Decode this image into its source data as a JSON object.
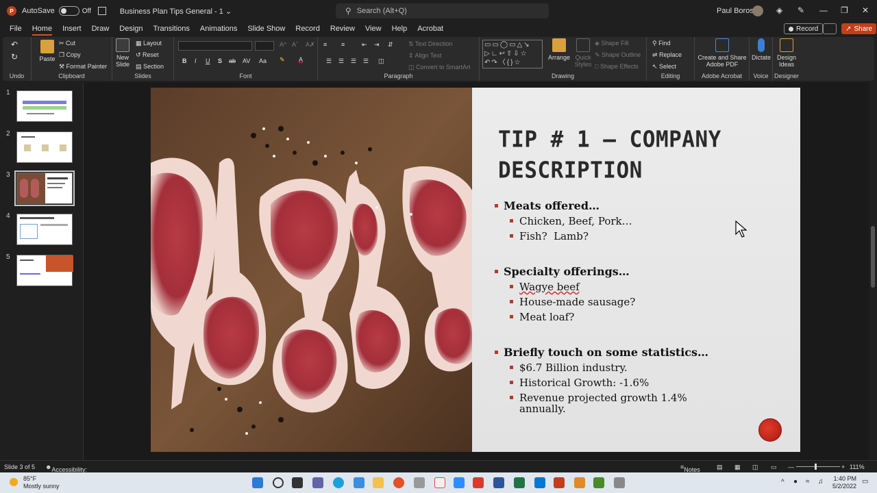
{
  "titlebar": {
    "autosave_label": "AutoSave",
    "autosave_state": "Off",
    "doc_title": "Business Plan Tips General - 1 ⌄",
    "search_placeholder": "Search (Alt+Q)",
    "user_name": "Paul Borosky"
  },
  "menu": {
    "items": [
      "File",
      "Home",
      "Insert",
      "Draw",
      "Design",
      "Transitions",
      "Animations",
      "Slide Show",
      "Record",
      "Review",
      "View",
      "Help",
      "Acrobat"
    ],
    "active": "Home",
    "record_label": "Record",
    "share_label": "Share"
  },
  "ribbon": {
    "undo": {
      "label": "Undo"
    },
    "clipboard": {
      "paste": "Paste",
      "cut": "Cut",
      "copy": "Copy",
      "format_painter": "Format Painter",
      "label": "Clipboard"
    },
    "slides": {
      "new_slide": "New Slide",
      "layout": "Layout",
      "reset": "Reset",
      "section": "Section",
      "label": "Slides"
    },
    "font": {
      "label": "Font",
      "bold": "B",
      "italic": "I",
      "underline": "U",
      "strike": "S",
      "ab": "ab",
      "aa": "Aa"
    },
    "paragraph": {
      "label": "Paragraph",
      "text_direction": "Text Direction",
      "align_text": "Align Text",
      "convert_smartart": "Convert to SmartArt"
    },
    "drawing": {
      "label": "Drawing",
      "arrange": "Arrange",
      "quick_styles": "Quick Styles",
      "shape_fill": "Shape Fill",
      "shape_outline": "Shape Outline",
      "shape_effects": "Shape Effects"
    },
    "editing": {
      "label": "Editing",
      "find": "Find",
      "replace": "Replace",
      "select": "Select"
    },
    "acrobat": {
      "label": "Adobe Acrobat",
      "create_share": "Create and Share Adobe PDF"
    },
    "voice": {
      "label": "Voice",
      "dictate": "Dictate"
    },
    "designer": {
      "label": "Designer",
      "design_ideas": "Design Ideas"
    }
  },
  "thumbnails": {
    "numbers": [
      "1",
      "2",
      "3",
      "4",
      "5"
    ],
    "active_index": 3
  },
  "slide": {
    "title_line1": "TIP # 1 – COMPANY",
    "title_line2": "DESCRIPTION",
    "sections": [
      {
        "heading": "Meats offered…",
        "items": [
          "Chicken, Beef, Pork…",
          "Fish?  Lamb?"
        ]
      },
      {
        "heading": "Specialty offerings…",
        "items": [
          "Wagye beef",
          "House-made sausage?",
          "Meat loaf?"
        ]
      },
      {
        "heading": "Briefly touch on some statistics…",
        "items": [
          "$6.7 Billion industry.",
          "Historical Growth: -1.6%",
          "Revenue projected growth 1.4%",
          "annually."
        ]
      }
    ]
  },
  "statusbar": {
    "slide_info": "Slide 3 of 5",
    "accessibility": "Accessibility: Investigate",
    "notes": "Notes",
    "zoom": "111%"
  },
  "taskbar": {
    "temp": "85°F",
    "weather": "Mostly sunny",
    "time": "1:40 PM",
    "date": "5/2/2022"
  },
  "colors": {
    "accent": "#d35230",
    "bullet": "#b23a2a"
  }
}
